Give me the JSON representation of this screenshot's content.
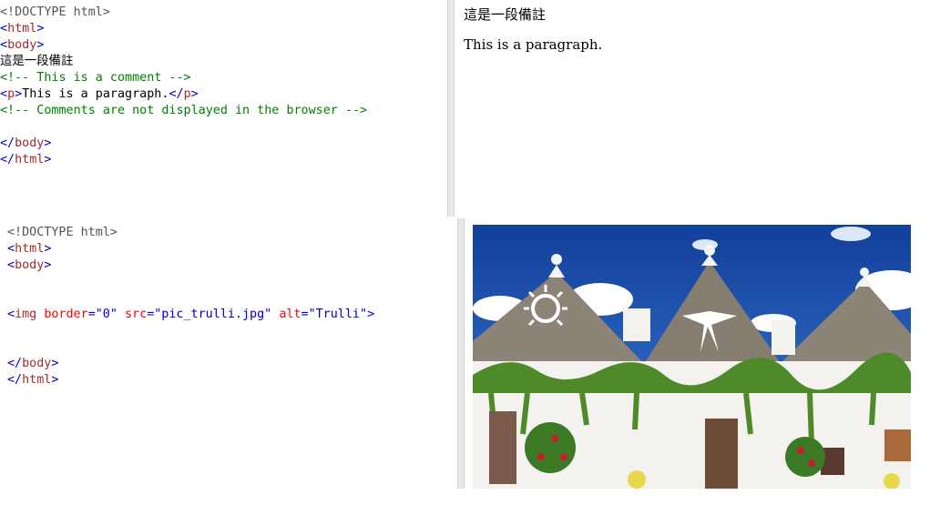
{
  "top_editor": {
    "lines": [
      [
        {
          "t": "<!DOCTYPE html>",
          "c": "grey"
        }
      ],
      [
        {
          "t": "<",
          "c": "blue"
        },
        {
          "t": "html",
          "c": "brown"
        },
        {
          "t": ">",
          "c": "blue"
        }
      ],
      [
        {
          "t": "<",
          "c": "blue"
        },
        {
          "t": "body",
          "c": "brown"
        },
        {
          "t": ">",
          "c": "blue"
        }
      ],
      [
        {
          "t": "這是一段備註",
          "c": ""
        }
      ],
      [
        {
          "t": "<!-- This is a comment -->",
          "c": "green"
        }
      ],
      [
        {
          "t": "<",
          "c": "blue"
        },
        {
          "t": "p",
          "c": "brown"
        },
        {
          "t": ">",
          "c": "blue"
        },
        {
          "t": "This is a paragraph.",
          "c": ""
        },
        {
          "t": "</",
          "c": "blue"
        },
        {
          "t": "p",
          "c": "brown"
        },
        {
          "t": ">",
          "c": "blue"
        }
      ],
      [
        {
          "t": "<!-- Comments are not displayed in the browser -->",
          "c": "green"
        }
      ],
      [
        {
          "t": "",
          "c": ""
        }
      ],
      [
        {
          "t": "</",
          "c": "blue"
        },
        {
          "t": "body",
          "c": "brown"
        },
        {
          "t": ">",
          "c": "blue"
        }
      ],
      [
        {
          "t": "</",
          "c": "blue"
        },
        {
          "t": "html",
          "c": "brown"
        },
        {
          "t": ">",
          "c": "blue"
        }
      ]
    ]
  },
  "top_result": {
    "comment_text": "這是一段備註",
    "paragraph": "This is a paragraph."
  },
  "bottom_editor": {
    "lines": [
      [
        {
          "t": "<!DOCTYPE html>",
          "c": "grey"
        }
      ],
      [
        {
          "t": "<",
          "c": "blue"
        },
        {
          "t": "html",
          "c": "brown"
        },
        {
          "t": ">",
          "c": "blue"
        }
      ],
      [
        {
          "t": "<",
          "c": "blue"
        },
        {
          "t": "body",
          "c": "brown"
        },
        {
          "t": ">",
          "c": "blue"
        }
      ],
      [
        {
          "t": "",
          "c": ""
        }
      ],
      [
        {
          "t": "",
          "c": ""
        }
      ],
      [
        {
          "t": "<",
          "c": "blue"
        },
        {
          "t": "img",
          "c": "brown"
        },
        {
          "t": " ",
          "c": ""
        },
        {
          "t": "border",
          "c": "red"
        },
        {
          "t": "=",
          "c": "blue"
        },
        {
          "t": "\"0\"",
          "c": "blue"
        },
        {
          "t": " ",
          "c": ""
        },
        {
          "t": "src",
          "c": "red"
        },
        {
          "t": "=",
          "c": "blue"
        },
        {
          "t": "\"pic_trulli.jpg\"",
          "c": "blue"
        },
        {
          "t": " ",
          "c": ""
        },
        {
          "t": "alt",
          "c": "red"
        },
        {
          "t": "=",
          "c": "blue"
        },
        {
          "t": "\"Trulli\"",
          "c": "blue"
        },
        {
          "t": ">",
          "c": "blue"
        }
      ],
      [
        {
          "t": "",
          "c": ""
        }
      ],
      [
        {
          "t": "",
          "c": ""
        }
      ],
      [
        {
          "t": "</",
          "c": "blue"
        },
        {
          "t": "body",
          "c": "brown"
        },
        {
          "t": ">",
          "c": "blue"
        }
      ],
      [
        {
          "t": "</",
          "c": "blue"
        },
        {
          "t": "html",
          "c": "brown"
        },
        {
          "t": ">",
          "c": "blue"
        }
      ]
    ]
  },
  "bottom_result": {
    "image_alt": "Trulli"
  },
  "colors": {
    "tag_name": "#a52a2a",
    "bracket": "#0000cd",
    "attribute": "#ff0000",
    "comment": "#008000",
    "doctype": "#555555",
    "sky": "#1f5fbf",
    "roof": "#8a8275",
    "wall": "#f4f2ee",
    "foliage": "#4f8a2a"
  }
}
